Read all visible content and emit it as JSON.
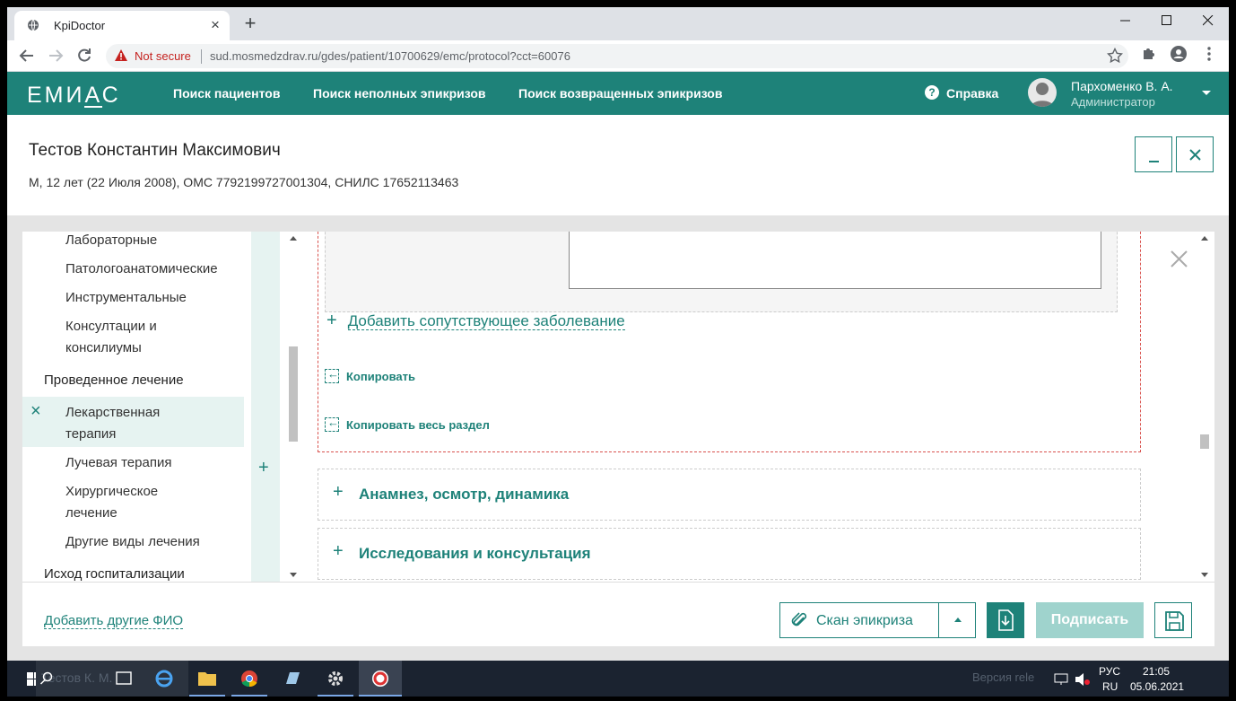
{
  "browser": {
    "tab_title": "KpiDoctor",
    "new_tab": "+",
    "security_label": "Not secure",
    "url": "sud.mosmedzdrav.ru/gdes/patient/10700629/emc/protocol?cct=60076"
  },
  "app": {
    "logo": "ЕМИАС",
    "nav": [
      "Поиск пациентов",
      "Поиск неполных эпикризов",
      "Поиск возвращенных эпикризов"
    ],
    "help": "Справка",
    "user_name": "Пархоменко В. А.",
    "user_role": "Администратор"
  },
  "patient": {
    "name": "Тестов Константин Максимович",
    "info": "М, 12 лет (22 Июля 2008), ОМС 7792199727001304, СНИЛС 17652113463"
  },
  "sidebar": {
    "items": [
      {
        "label": "Лабораторные"
      },
      {
        "label": "Патологоанатомические"
      },
      {
        "label": "Инструментальные"
      },
      {
        "label": "Консултации и\nконсилиумы"
      },
      {
        "label": "Проведенное лечение"
      },
      {
        "label": "Лекарственная\nтерапия"
      },
      {
        "label": "Лучевая терапия"
      },
      {
        "label": "Хирургическое\nлечение"
      },
      {
        "label": "Другие виды лечения"
      },
      {
        "label": "Исход госпитализации"
      }
    ],
    "active_index": 5
  },
  "main": {
    "add_comorbidity": "Добавить сопутствующее заболевание",
    "copy": "Копировать",
    "copy_section": "Копировать весь раздел",
    "sections": [
      "Анамнез, осмотр, динамика",
      "Исследования и консультация"
    ]
  },
  "footer": {
    "add_fio": "Добавить другие ФИО",
    "scan": "Скан эпикриза",
    "sign": "Подписать"
  },
  "taskbar": {
    "search_text": "Тестов К. М.",
    "faint_text": "Версия rele",
    "lang": "РУС",
    "lang_sub": "RU",
    "time": "21:05",
    "date": "05.06.2021"
  },
  "colors": {
    "accent": "#1e8279",
    "accent_light": "#e6f3f1",
    "error_dashed": "#d9534f"
  }
}
